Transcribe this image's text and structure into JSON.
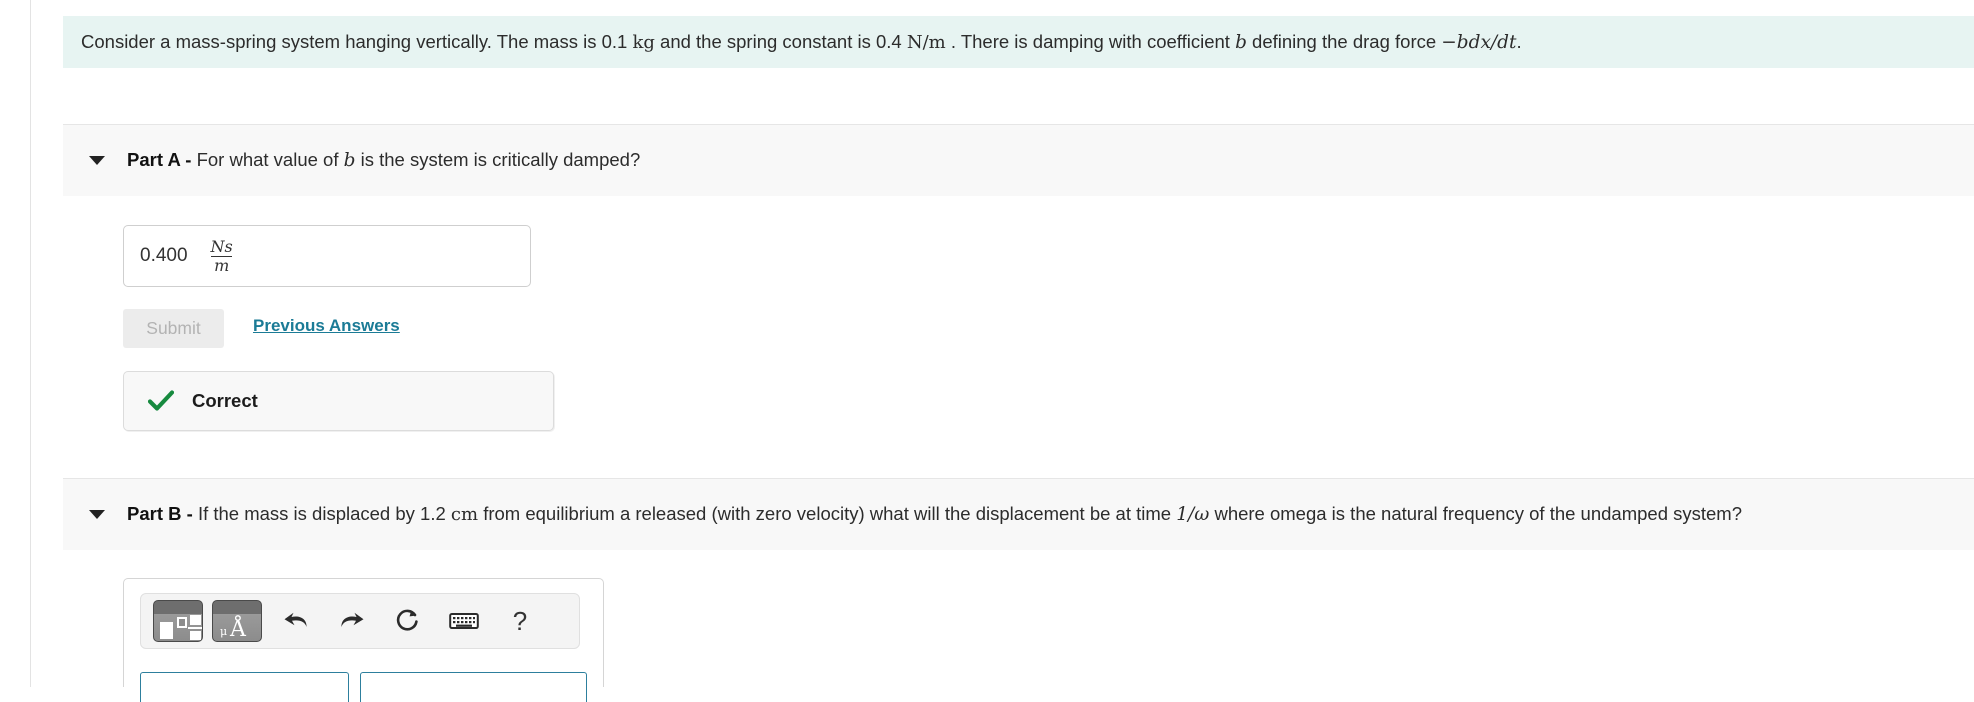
{
  "statement": {
    "text_1": "Consider a mass-spring system hanging vertically. The mass is 0.1",
    "math_kg": "kg",
    "text_2": "and the spring constant is 0.4",
    "math_nm": "N/m",
    "text_3": ". There is damping with coefficient",
    "math_b": "b",
    "text_4": "defining the drag force",
    "math_drag": "−bdx/dt",
    "text_5": "."
  },
  "parts": [
    {
      "id": "part-a",
      "label": "Part A -",
      "question_1": "For what value of",
      "question_math": "b",
      "question_2": "is the system is critically damped?",
      "caret_icon": "caret-down-icon",
      "expanded": true,
      "answer": {
        "value": "0.400",
        "unit_numerator": "Ns",
        "unit_denominator": "m",
        "placeholder": ""
      },
      "submit_label": "Submit",
      "submit_disabled": true,
      "previous_answers_label": "Previous Answers",
      "feedback": {
        "status": "Correct",
        "icon": "check-icon",
        "color": "#178a3f"
      }
    },
    {
      "id": "part-b",
      "label": "Part B -",
      "question_1": "If the mass is displaced by 1.2",
      "question_math_cm": "cm",
      "question_2": "from equilibrium a released (with zero velocity) what will the displacement be at time",
      "question_math_t": "1/ω",
      "question_3": "where omega is the natural frequency of the undamped system?",
      "caret_icon": "caret-down-icon",
      "expanded": true
    }
  ],
  "math_editor": {
    "toolbar": [
      {
        "name": "templates-button",
        "icon": "math-templates-icon",
        "label": ""
      },
      {
        "name": "symbols-button",
        "icon": "greek-symbols-icon",
        "label": "μÅ"
      },
      {
        "name": "undo-button",
        "icon": "undo-arrow-icon",
        "label": ""
      },
      {
        "name": "redo-button",
        "icon": "redo-arrow-icon",
        "label": ""
      },
      {
        "name": "reset-button",
        "icon": "reset-circular-arrow-icon",
        "label": ""
      },
      {
        "name": "keyboard-button",
        "icon": "keyboard-icon",
        "label": ""
      },
      {
        "name": "help-button",
        "icon": "question-mark-icon",
        "label": "?"
      }
    ],
    "fields": [
      {
        "name": "math-answer-field-left",
        "value": ""
      },
      {
        "name": "math-answer-field-right",
        "value": ""
      }
    ]
  },
  "colors": {
    "statement_bg": "#e7f4f2",
    "band_bg": "#f8f8f8",
    "link": "#1b7b96",
    "correct_green": "#178a3f",
    "field_border": "#2d7f9d"
  }
}
